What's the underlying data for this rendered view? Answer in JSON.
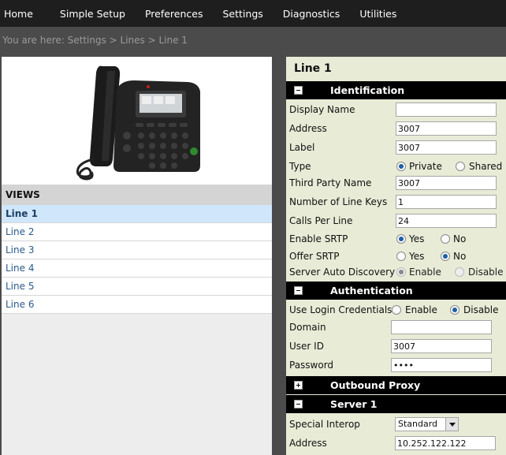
{
  "nav": {
    "items": [
      "Home",
      "Simple Setup",
      "Preferences",
      "Settings",
      "Diagnostics",
      "Utilities"
    ]
  },
  "breadcrumb": "You are here: Settings > Lines > Line 1",
  "views": {
    "header": "VIEWS",
    "items": [
      "Line 1",
      "Line 2",
      "Line 3",
      "Line 4",
      "Line 5",
      "Line 6"
    ],
    "active_index": 0
  },
  "page_title": "Line 1",
  "sections": {
    "identification": "Identification",
    "authentication": "Authentication",
    "outbound_proxy": "Outbound Proxy",
    "server1": "Server 1"
  },
  "fields": {
    "display_name": {
      "label": "Display Name",
      "value": ""
    },
    "address": {
      "label": "Address",
      "value": "3007"
    },
    "label": {
      "label": "Label",
      "value": "3007"
    },
    "type": {
      "label": "Type",
      "options": [
        "Private",
        "Shared"
      ],
      "selected": "Private"
    },
    "third_party_name": {
      "label": "Third Party Name",
      "value": "3007"
    },
    "num_line_keys": {
      "label": "Number of Line Keys",
      "value": "1"
    },
    "calls_per_line": {
      "label": "Calls Per Line",
      "value": "24"
    },
    "enable_srtp": {
      "label": "Enable SRTP",
      "options": [
        "Yes",
        "No"
      ],
      "selected": "Yes"
    },
    "offer_srtp": {
      "label": "Offer SRTP",
      "options": [
        "Yes",
        "No"
      ],
      "selected": "No"
    },
    "server_auto_discovery": {
      "label": "Server Auto Discovery",
      "options": [
        "Enable",
        "Disable"
      ],
      "selected": "Enable",
      "disabled": true
    },
    "use_login_credentials": {
      "label": "Use Login Credentials",
      "options": [
        "Enable",
        "Disable"
      ],
      "selected": "Disable"
    },
    "domain": {
      "label": "Domain",
      "value": ""
    },
    "user_id": {
      "label": "User ID",
      "value": "3007"
    },
    "password": {
      "label": "Password",
      "value": "••••"
    },
    "special_interop": {
      "label": "Special Interop",
      "value": "Standard"
    },
    "server_address": {
      "label": "Address",
      "value": "10.252.122.122"
    }
  },
  "colors": {
    "nav_bg": "#1e1e1e",
    "page_bg": "#4b4b4b",
    "right_panel_bg": "#e8ebd6",
    "active_view_bg": "#cfe6fb",
    "section_bar_bg": "#000000"
  }
}
